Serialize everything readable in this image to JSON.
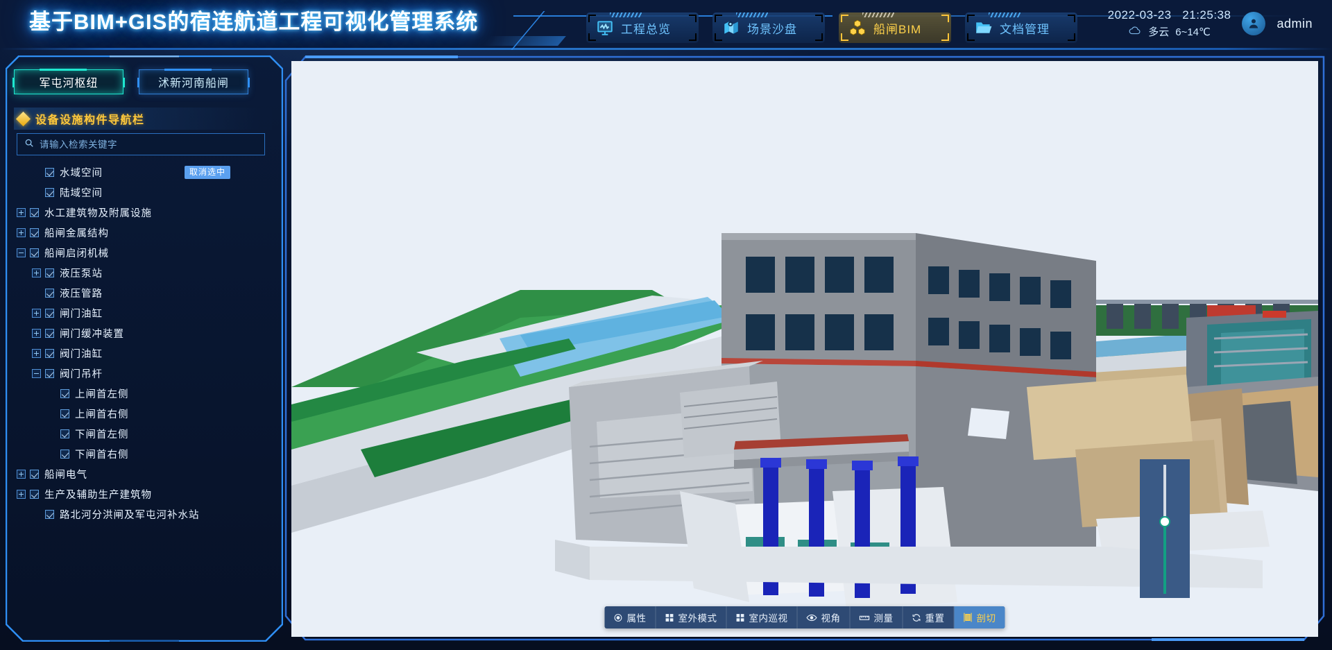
{
  "header": {
    "title": "基于BIM+GIS的宿连航道工程可视化管理系统",
    "nav_tabs": [
      {
        "label": "工程总览",
        "icon": "presentation-chart-icon",
        "active": false
      },
      {
        "label": "场景沙盘",
        "icon": "map-pin-icon",
        "active": false
      },
      {
        "label": "船闸BIM",
        "icon": "cubes-icon",
        "active": true
      },
      {
        "label": "文档管理",
        "icon": "folder-open-icon",
        "active": false
      }
    ],
    "status": {
      "date": "2022-03-23",
      "time": "21:25:38",
      "weather_icon": "cloud-icon",
      "weather": "多云",
      "temperature": "6~14℃",
      "avatar_icon": "user-avatar-icon",
      "username": "admin"
    }
  },
  "sidebar": {
    "project_tabs": [
      {
        "label": "军屯河枢纽",
        "active": true
      },
      {
        "label": "沭新河南船闸",
        "active": false
      }
    ],
    "panel_title": "设备设施构件导航栏",
    "panel_icon": "diamond-icon",
    "search": {
      "icon": "search-icon",
      "placeholder": "请输入检索关键字",
      "value": ""
    },
    "deselect_badge": "取消选中",
    "tree": [
      {
        "label": "水域空间",
        "indent": 1,
        "expander": "none",
        "checked": true,
        "badge": true
      },
      {
        "label": "陆域空间",
        "indent": 1,
        "expander": "none",
        "checked": true
      },
      {
        "label": "水工建筑物及附属设施",
        "indent": 0,
        "expander": "plus",
        "checked": true
      },
      {
        "label": "船闸金属结构",
        "indent": 0,
        "expander": "plus",
        "checked": true
      },
      {
        "label": "船闸启闭机械",
        "indent": 0,
        "expander": "minus",
        "checked": true
      },
      {
        "label": "液压泵站",
        "indent": 1,
        "expander": "plus",
        "checked": true
      },
      {
        "label": "液压管路",
        "indent": 1,
        "expander": "none",
        "checked": true
      },
      {
        "label": "闸门油缸",
        "indent": 1,
        "expander": "plus",
        "checked": true
      },
      {
        "label": "闸门缓冲装置",
        "indent": 1,
        "expander": "plus",
        "checked": true
      },
      {
        "label": "阀门油缸",
        "indent": 1,
        "expander": "plus",
        "checked": true
      },
      {
        "label": "阀门吊杆",
        "indent": 1,
        "expander": "minus",
        "checked": true
      },
      {
        "label": "上闸首左侧",
        "indent": 2,
        "expander": "none",
        "checked": true
      },
      {
        "label": "上闸首右侧",
        "indent": 2,
        "expander": "none",
        "checked": true
      },
      {
        "label": "下闸首左侧",
        "indent": 2,
        "expander": "none",
        "checked": true
      },
      {
        "label": "下闸首右侧",
        "indent": 2,
        "expander": "none",
        "checked": true
      },
      {
        "label": "船闸电气",
        "indent": 0,
        "expander": "plus",
        "checked": true
      },
      {
        "label": "生产及辅助生产建筑物",
        "indent": 0,
        "expander": "plus",
        "checked": true
      },
      {
        "label": "路北河分洪闸及军屯河补水站",
        "indent": 1,
        "expander": "none",
        "checked": true
      }
    ]
  },
  "viewer": {
    "toolbar": [
      {
        "label": "属性",
        "icon": "target-icon",
        "active": false
      },
      {
        "label": "室外模式",
        "icon": "grid-squares-icon",
        "active": false
      },
      {
        "label": "室内巡视",
        "icon": "grid-squares-icon",
        "active": false
      },
      {
        "label": "视角",
        "icon": "eye-icon",
        "active": false
      },
      {
        "label": "测量",
        "icon": "ruler-icon",
        "active": false
      },
      {
        "label": "重置",
        "icon": "refresh-icon",
        "active": false
      },
      {
        "label": "剖切",
        "icon": "section-cut-icon",
        "active": true
      }
    ],
    "cut_panel": {
      "slider_name": "section-cut-slider",
      "value_percent": 51
    }
  },
  "colors": {
    "accent_blue": "#2f8ff5",
    "accent_cyan": "#1ee8d0",
    "accent_gold": "#ffc93c",
    "panel_bg": "#0a1a3a",
    "viewer_bg": "#e9eff7"
  }
}
